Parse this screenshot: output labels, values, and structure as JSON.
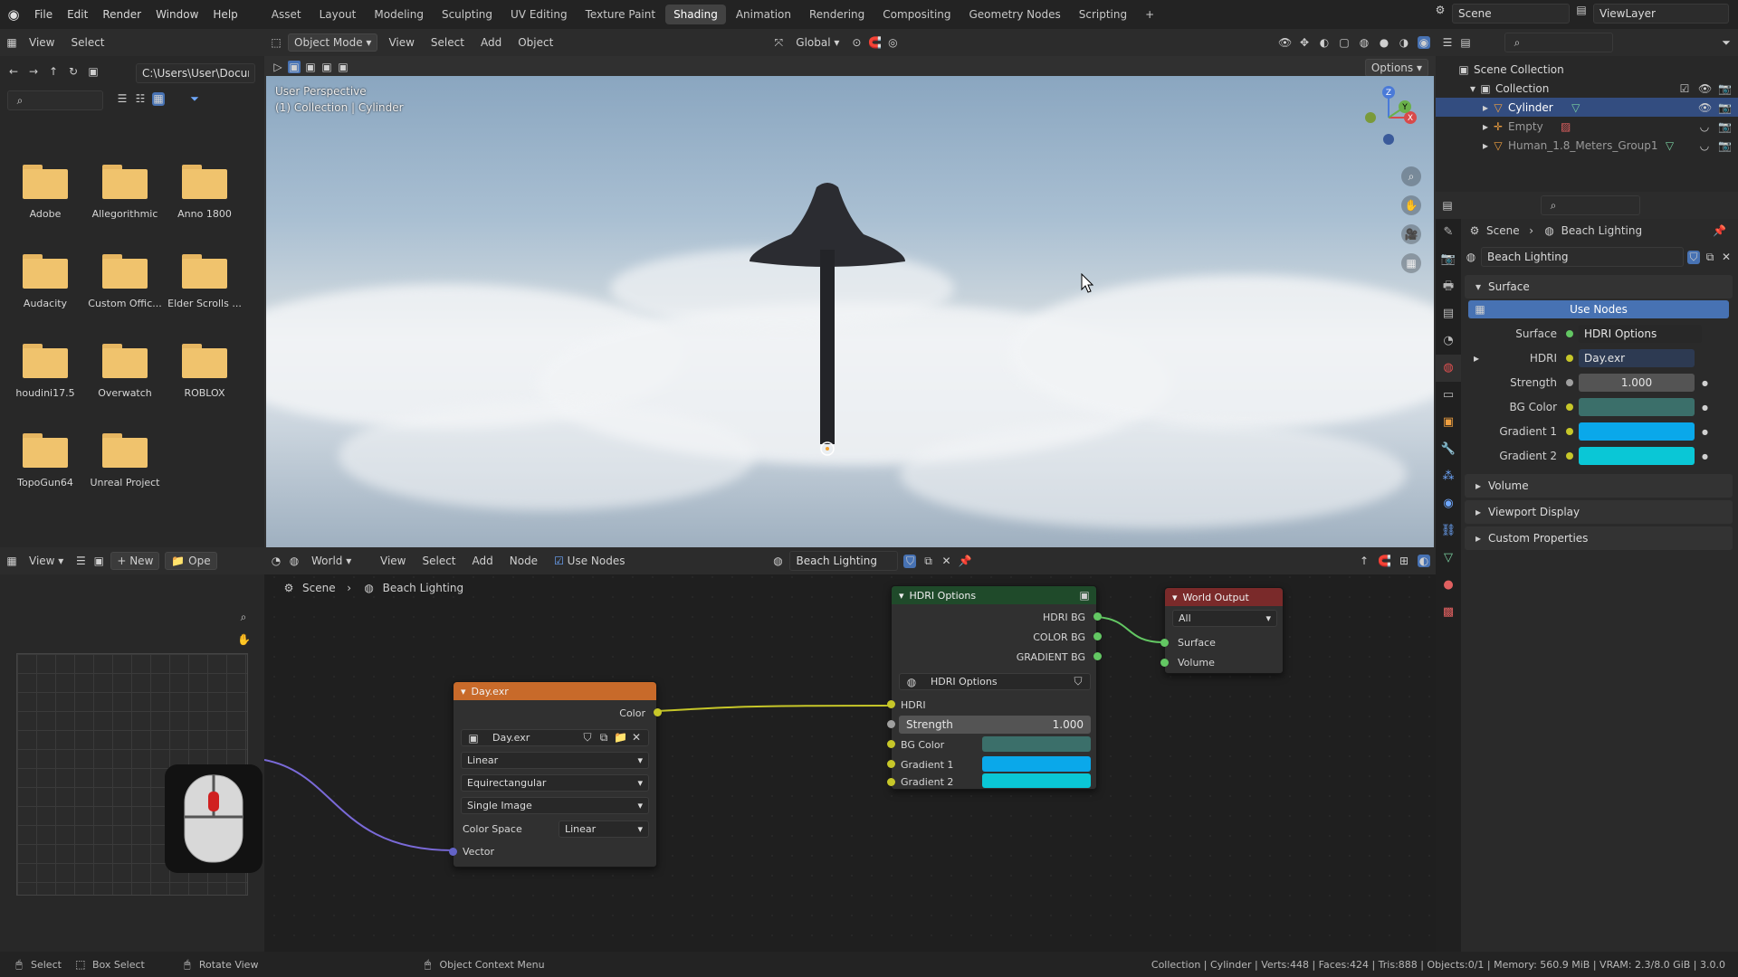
{
  "menu": {
    "items": [
      "File",
      "Edit",
      "Render",
      "Window",
      "Help"
    ],
    "workspaces": [
      "Asset",
      "Layout",
      "Modeling",
      "Sculpting",
      "UV Editing",
      "Texture Paint",
      "Shading",
      "Animation",
      "Rendering",
      "Compositing",
      "Geometry Nodes",
      "Scripting"
    ],
    "active_workspace": "Shading",
    "add_tab": "+",
    "scene": "Scene",
    "view_layer": "ViewLayer"
  },
  "file_browser": {
    "menu": [
      "View",
      "Select"
    ],
    "path": "C:\\Users\\User\\Docum...",
    "folders": [
      "Adobe",
      "Allegorithmic",
      "Anno 1800",
      "Audacity",
      "Custom Offic...",
      "Elder Scrolls ...",
      "houdini17.5",
      "Overwatch",
      "ROBLOX",
      "TopoGun64",
      "Unreal Project"
    ]
  },
  "viewport": {
    "mode": "Object Mode",
    "menu": [
      "View",
      "Select",
      "Add",
      "Object"
    ],
    "transform": "Global",
    "options": "Options",
    "perspective": "User Perspective",
    "context": "(1) Collection | Cylinder",
    "gizmo": {
      "z": "Z",
      "y": "Y",
      "x": "X"
    }
  },
  "outliner": {
    "rows": [
      {
        "label": "Scene Collection"
      },
      {
        "label": "Collection"
      },
      {
        "label": "Cylinder"
      },
      {
        "label": "Empty"
      },
      {
        "label": "Human_1.8_Meters_Group1"
      }
    ]
  },
  "properties": {
    "breadcrumb": {
      "scene": "Scene",
      "world": "Beach Lighting"
    },
    "world_name": "Beach Lighting",
    "surface_section": "Surface",
    "use_nodes": "Use Nodes",
    "surface_label": "Surface",
    "surface_value": "HDRI Options",
    "hdri_label": "HDRI",
    "hdri_value": "Day.exr",
    "strength_label": "Strength",
    "strength_value": "1.000",
    "bg_color_label": "BG Color",
    "gradient1_label": "Gradient 1",
    "gradient2_label": "Gradient 2",
    "volume_section": "Volume",
    "viewport_display_section": "Viewport Display",
    "custom_props_section": "Custom Properties",
    "colors": {
      "bg_color": "#3b6f6a",
      "gradient1": "#0aa8ea",
      "gradient2": "#0ac7d6",
      "selection": "#4772b3"
    }
  },
  "node_editor": {
    "view": "View",
    "new": "New",
    "open": "Ope",
    "world": "World",
    "menu": [
      "View",
      "Select",
      "Add",
      "Node"
    ],
    "use_nodes": "Use Nodes",
    "world_name": "Beach Lighting",
    "breadcrumb": {
      "scene": "Scene",
      "world": "Beach Lighting"
    },
    "image_node": {
      "title": "Day.exr",
      "output": "Color",
      "image": "Day.exr",
      "interpolation": "Linear",
      "projection": "Equirectangular",
      "source": "Single Image",
      "color_space_label": "Color Space",
      "color_space": "Linear",
      "input": "Vector"
    },
    "hdri_node": {
      "title": "HDRI Options",
      "outputs": [
        "HDRI BG",
        "COLOR BG",
        "GRADIENT BG"
      ],
      "group": "HDRI Options",
      "in_hdri": "HDRI",
      "strength_label": "Strength",
      "strength_value": "1.000",
      "bg_color": "BG Color",
      "gradient1": "Gradient 1",
      "gradient2": "Gradient 2"
    },
    "output_node": {
      "title": "World Output",
      "target": "All",
      "surface": "Surface",
      "volume": "Volume"
    }
  },
  "status_bar": {
    "select": "Select",
    "box_select": "Box Select",
    "rotate_view": "Rotate View",
    "context_menu": "Object Context Menu",
    "stats": "Collection | Cylinder | Verts:448 | Faces:424 | Tris:888 | Objects:0/1 | Memory: 560.9 MiB | VRAM: 2.3/8.0 GiB | 3.0.0"
  }
}
